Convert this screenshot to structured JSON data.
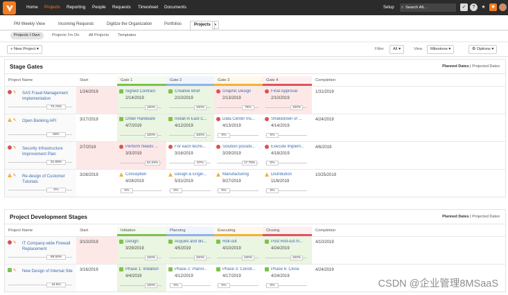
{
  "topnav": {
    "items": [
      "Home",
      "Projects",
      "Reporting",
      "People",
      "Requests",
      "Timesheet",
      "Documents"
    ],
    "active": "Projects",
    "setup": "Setup",
    "search_placeholder": "Search All..."
  },
  "tabs": {
    "items": [
      "PM Weekly View",
      "Incoming Requests",
      "Digitize the Organization",
      "Portfolios",
      "Projects"
    ],
    "active": "Projects"
  },
  "subtabs": {
    "items": [
      "Projects I Own",
      "Projects I'm On",
      "All Projects",
      "Templates"
    ],
    "active": "Projects I Own"
  },
  "toolbar": {
    "new_project": "New Project",
    "filter_label": "Filter",
    "filter_value": "All",
    "view_label": "View",
    "view_value": "Milestone",
    "options": "Options"
  },
  "sections": [
    {
      "title": "Stage Gates",
      "dates_active": "Planned Dates",
      "dates_other": "Projected Dates",
      "columns": [
        "Project Name",
        "Start",
        "Gate 1",
        "Gate 2",
        "Gate 3",
        "Gate 4",
        "Completion"
      ],
      "column_colors": [
        "",
        "",
        "#7dc24b",
        "#8fb3e6",
        "#f2b233",
        "#e0525a",
        ""
      ],
      "rows": [
        {
          "name": "SAS Fraud Management Implementation",
          "status": "red",
          "progress": "70.76%",
          "start": "1/24/2019",
          "completion": "1/31/2019",
          "start_bg": "#fde8e8",
          "milestones": [
            {
              "name": "Signed Contract",
              "date": "2/14/2019",
              "pct": "100%",
              "icon": "sq-green",
              "bg": "#eaf5e2"
            },
            {
              "name": "Creative Brief",
              "date": "2/10/2019",
              "pct": "100%",
              "icon": "sq-green",
              "bg": "#eaf5e2"
            },
            {
              "name": "Graphic Design",
              "date": "2/13/2019",
              "pct": "75%",
              "icon": "dot-red",
              "bg": "#fde8e8"
            },
            {
              "name": "Final Approval",
              "date": "2/10/2019",
              "pct": "100%",
              "icon": "dot-red",
              "bg": "#fde8e8"
            }
          ]
        },
        {
          "name": "Open Banking API",
          "status": "yellow",
          "progress": "60%",
          "start": "3/17/2019",
          "completion": "4/24/2019",
          "start_bg": "#fff",
          "milestones": [
            {
              "name": "Order Hardware",
              "date": "4/7/2019",
              "pct": "100%",
              "icon": "sq-green",
              "bg": "#eaf5e2"
            },
            {
              "name": "Install in East C...",
              "date": "4/12/2019",
              "pct": "100%",
              "icon": "sq-green",
              "bg": "#eaf5e2"
            },
            {
              "name": "Data Center Ins...",
              "date": "4/13/2019",
              "pct": "0%",
              "icon": "dot-red",
              "bg": "#fff"
            },
            {
              "name": "Shakedown of ...",
              "date": "4/14/2019",
              "pct": "0%",
              "icon": "dot-red",
              "bg": "#fff"
            }
          ]
        },
        {
          "name": "Security Infrastructure Improvement Plan",
          "status": "red",
          "progress": "31.69%",
          "start": "2/7/2019",
          "completion": "4/6/2019",
          "start_bg": "#fde8e8",
          "milestones": [
            {
              "name": "Perform Needs ...",
              "date": "3/3/2019",
              "pct": "64.29%",
              "icon": "dot-red",
              "bg": "#fde8e8"
            },
            {
              "name": "For each techn...",
              "date": "3/16/2019",
              "pct": "67%",
              "icon": "dot-red",
              "bg": "#fff"
            },
            {
              "name": "Solution possibi...",
              "date": "3/29/2019",
              "pct": "17.78%",
              "icon": "dot-red",
              "bg": "#fff"
            },
            {
              "name": "Execute Implem...",
              "date": "4/18/2019",
              "pct": "0%",
              "icon": "dot-red",
              "bg": "#fff"
            }
          ]
        },
        {
          "name": "Re-design of Customer Tutorials",
          "status": "yellow",
          "progress": "0%",
          "start": "3/28/2019",
          "completion": "10/25/2019",
          "start_bg": "#fff",
          "milestones": [
            {
              "name": "Conception",
              "date": "4/28/2019",
              "pct": "0%",
              "icon": "tri",
              "bg": "#fff"
            },
            {
              "name": "Design & Engin...",
              "date": "5/31/2019",
              "pct": "0%",
              "icon": "tri",
              "bg": "#fff"
            },
            {
              "name": "Manufacturing",
              "date": "9/27/2019",
              "pct": "0%",
              "icon": "tri",
              "bg": "#fff"
            },
            {
              "name": "Distribution",
              "date": "11/8/2019",
              "pct": "0%",
              "icon": "tri",
              "bg": "#fff"
            }
          ]
        }
      ]
    },
    {
      "title": "Project Development Stages",
      "dates_active": "Planned Dates",
      "dates_other": "Projected Dates",
      "columns": [
        "Project Name",
        "Start",
        "Initiation",
        "Planning",
        "Executing",
        "Closing",
        "Completion"
      ],
      "column_colors": [
        "",
        "",
        "#7dc24b",
        "#8fb3e6",
        "#f2b233",
        "#e0525a",
        ""
      ],
      "rows": [
        {
          "name": "IT Company-wide Firewall Replacement",
          "status": "red",
          "progress": "99.58%",
          "start": "3/10/2019",
          "completion": "4/10/2019",
          "start_bg": "#fde8e8",
          "milestones": [
            {
              "name": "Design",
              "date": "3/29/2019",
              "pct": "100%",
              "icon": "sq-green",
              "bg": "#eaf5e2"
            },
            {
              "name": "Acquire and dis...",
              "date": "4/5/2019",
              "pct": "100%",
              "icon": "sq-green",
              "bg": "#eaf5e2"
            },
            {
              "name": "Roll-out",
              "date": "4/10/2019",
              "pct": "100%",
              "icon": "sq-green",
              "bg": "#eaf5e2"
            },
            {
              "name": "Post Roll-out m...",
              "date": "4/24/2019",
              "pct": "100%",
              "icon": "sq-green",
              "bg": "#eaf5e2"
            }
          ]
        },
        {
          "name": "New Design of Internal Site",
          "status": "green",
          "progress": "44.5%",
          "start": "3/16/2019",
          "completion": "4/24/2019",
          "start_bg": "#fff",
          "milestones": [
            {
              "name": "Phase 1: Initiation",
              "date": "4/4/2019",
              "pct": "100%",
              "icon": "sq-green",
              "bg": "#eaf5e2"
            },
            {
              "name": "Phase 2: Planni...",
              "date": "4/12/2019",
              "pct": "0%",
              "icon": "sq-green",
              "bg": "#fff"
            },
            {
              "name": "Phase 3: Constr...",
              "date": "4/17/2019",
              "pct": "0%",
              "icon": "sq-green",
              "bg": "#fff"
            },
            {
              "name": "Phase 6: Close",
              "date": "4/24/2019",
              "pct": "0%",
              "icon": "sq-green",
              "bg": "#fff"
            }
          ]
        }
      ]
    }
  ],
  "watermark": "CSDN @企业管理8MSaaS"
}
